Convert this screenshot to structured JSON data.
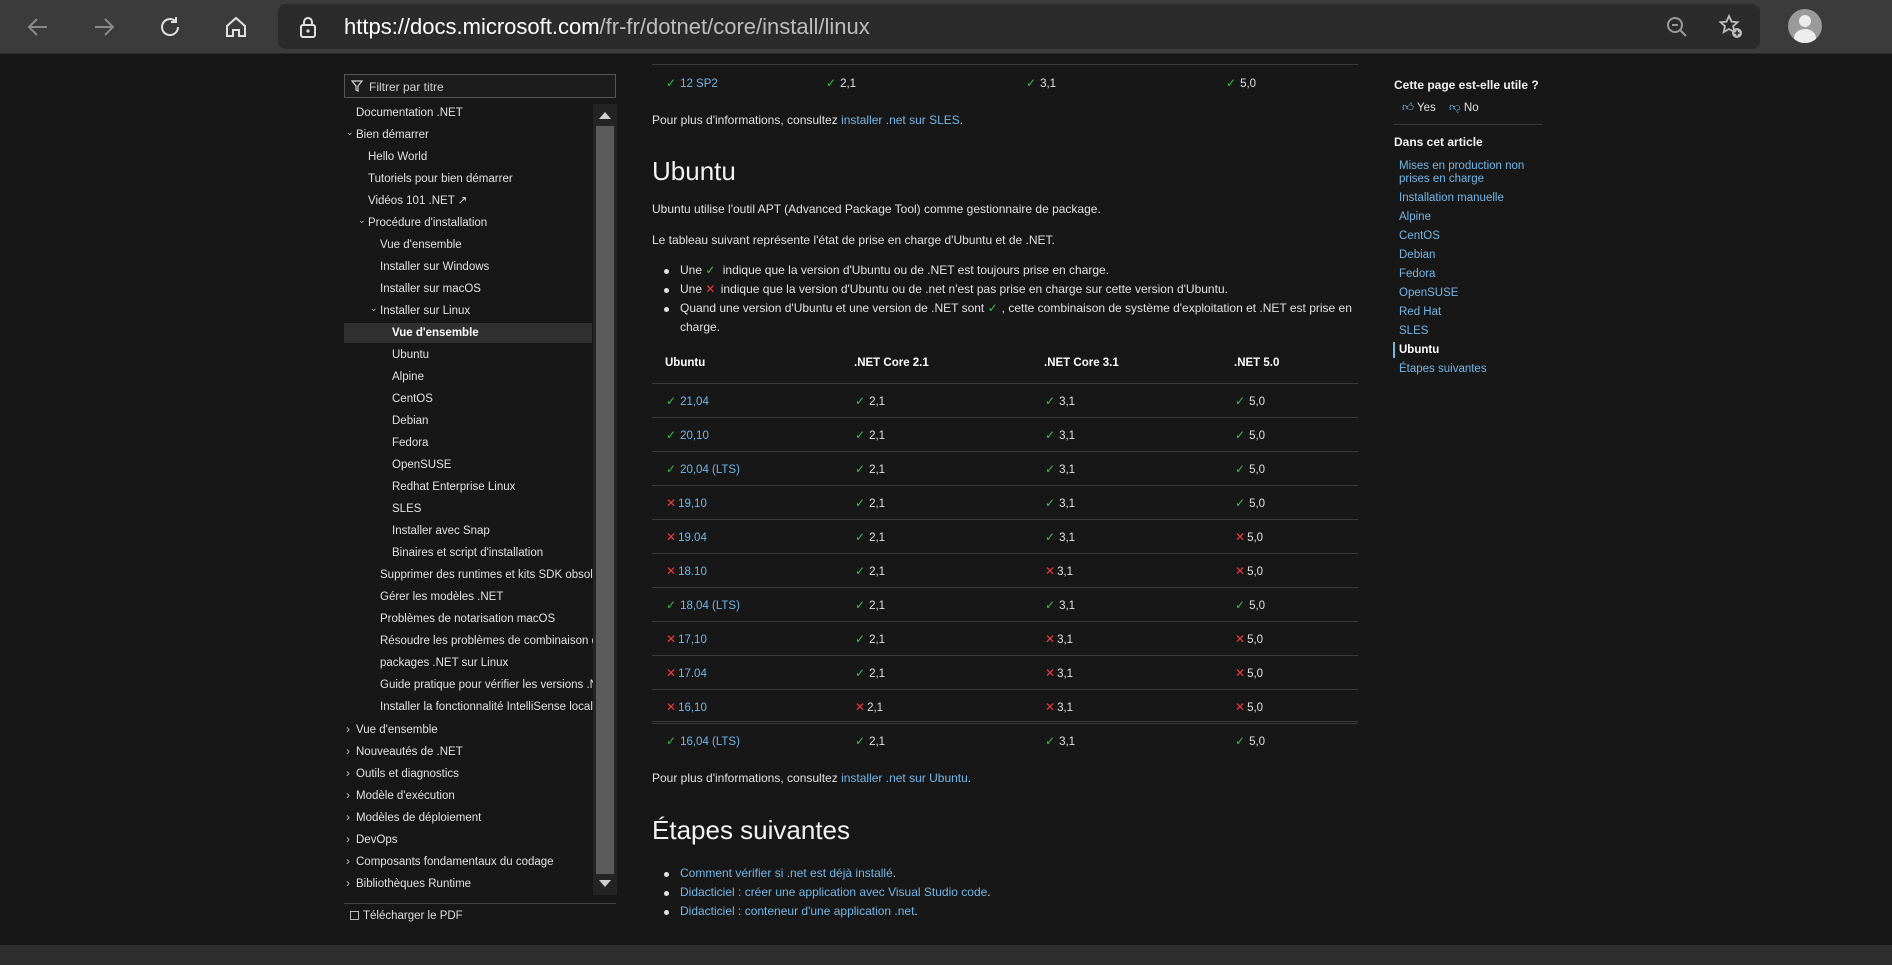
{
  "browser": {
    "url_host": "https://docs.microsoft.com",
    "url_path": "/fr-fr/dotnet/core/install/linux"
  },
  "toc": {
    "filter_placeholder": "Filtrer par titre",
    "items": [
      {
        "label": "Documentation .NET",
        "level": 0,
        "caret": ""
      },
      {
        "label": "Bien démarrer",
        "level": 0,
        "caret": "open"
      },
      {
        "label": "Hello World",
        "level": 1,
        "caret": ""
      },
      {
        "label": "Tutoriels pour bien démarrer",
        "level": 1,
        "caret": ""
      },
      {
        "label": "Vidéos 101 .NET ↗",
        "level": 1,
        "caret": ""
      },
      {
        "label": "Procédure d'installation",
        "level": 1,
        "caret": "open"
      },
      {
        "label": "Vue d'ensemble",
        "level": 2,
        "caret": ""
      },
      {
        "label": "Installer sur Windows",
        "level": 2,
        "caret": ""
      },
      {
        "label": "Installer sur macOS",
        "level": 2,
        "caret": ""
      },
      {
        "label": "Installer sur Linux",
        "level": 2,
        "caret": "open"
      },
      {
        "label": "Vue d'ensemble",
        "level": 3,
        "caret": "",
        "selected": true
      },
      {
        "label": "Ubuntu",
        "level": 3,
        "caret": ""
      },
      {
        "label": "Alpine",
        "level": 3,
        "caret": ""
      },
      {
        "label": "CentOS",
        "level": 3,
        "caret": ""
      },
      {
        "label": "Debian",
        "level": 3,
        "caret": ""
      },
      {
        "label": "Fedora",
        "level": 3,
        "caret": ""
      },
      {
        "label": "OpenSUSE",
        "level": 3,
        "caret": ""
      },
      {
        "label": "Redhat Enterprise Linux",
        "level": 3,
        "caret": ""
      },
      {
        "label": "SLES",
        "level": 3,
        "caret": ""
      },
      {
        "label": "Installer avec Snap",
        "level": 3,
        "caret": ""
      },
      {
        "label": "Binaires et script d'installation",
        "level": 3,
        "caret": ""
      },
      {
        "label": "Supprimer des runtimes et kits SDK obsolètes",
        "level": 2,
        "caret": ""
      },
      {
        "label": "Gérer les modèles .NET",
        "level": 2,
        "caret": ""
      },
      {
        "label": "Problèmes de notarisation macOS",
        "level": 2,
        "caret": ""
      },
      {
        "label": "Résoudre les problèmes de combinaison de",
        "level": 2,
        "caret": ""
      },
      {
        "label": "packages .NET sur Linux",
        "level": 2,
        "caret": "",
        "continuation": true
      },
      {
        "label": "Guide pratique pour vérifier les versions .NET",
        "level": 2,
        "caret": ""
      },
      {
        "label": "Installer la fonctionnalité IntelliSense localisée",
        "level": 2,
        "caret": ""
      },
      {
        "label": "Vue d'ensemble",
        "level": 0,
        "caret": "closed"
      },
      {
        "label": "Nouveautés de .NET",
        "level": 0,
        "caret": "closed"
      },
      {
        "label": "Outils et diagnostics",
        "level": 0,
        "caret": "closed"
      },
      {
        "label": "Modèle d'exécution",
        "level": 0,
        "caret": "closed"
      },
      {
        "label": "Modèles de déploiement",
        "level": 0,
        "caret": "closed"
      },
      {
        "label": "DevOps",
        "level": 0,
        "caret": "closed"
      },
      {
        "label": "Composants fondamentaux du codage",
        "level": 0,
        "caret": "closed"
      },
      {
        "label": "Bibliothèques Runtime",
        "level": 0,
        "caret": "closed"
      }
    ],
    "pdf_label": "Télécharger le PDF"
  },
  "main": {
    "sles_row": {
      "os": "12 SP2",
      "c21": "2,1",
      "c31": "3,1",
      "n5": "5,0"
    },
    "sles_more_prefix": "Pour plus d'informations, consultez ",
    "sles_more_link": "installer .net sur SLES",
    "sles_more_suffix": ".",
    "ubuntu_heading": "Ubuntu",
    "ubuntu_intro": "Ubuntu utilise l'outil APT (Advanced Package Tool) comme gestionnaire de package.",
    "table_intro": "Le tableau suivant représente l'état de prise en charge d'Ubuntu et de .NET.",
    "bullet1_a": "Une ",
    "bullet1_b": " indique que la version d'Ubuntu ou de .NET est toujours prise en charge.",
    "bullet2_a": "Une ",
    "bullet2_b": " indique que la version d'Ubuntu ou de .net n'est pas prise en charge sur cette version d'Ubuntu.",
    "bullet3_a": "Quand une version d'Ubuntu et une version de .NET sont ",
    "bullet3_b": ", cette combinaison de système d'exploitation et .NET est prise en",
    "bullet3_c": "charge.",
    "table_headers": [
      "Ubuntu",
      ".NET Core 2.1",
      ".NET Core 3.1",
      ".NET 5.0"
    ],
    "table_rows": [
      {
        "os": "21,04",
        "os_ok": true,
        "c21": "2,1",
        "c21_ok": true,
        "c31": "3,1",
        "c31_ok": true,
        "n5": "5,0",
        "n5_ok": true
      },
      {
        "os": "20,10",
        "os_ok": true,
        "c21": "2,1",
        "c21_ok": true,
        "c31": "3,1",
        "c31_ok": true,
        "n5": "5,0",
        "n5_ok": true
      },
      {
        "os": "20,04 (LTS)",
        "os_ok": true,
        "c21": "2,1",
        "c21_ok": true,
        "c31": "3,1",
        "c31_ok": true,
        "n5": "5,0",
        "n5_ok": true
      },
      {
        "os": "19,10",
        "os_ok": false,
        "c21": "2,1",
        "c21_ok": true,
        "c31": "3,1",
        "c31_ok": true,
        "n5": "5,0",
        "n5_ok": true
      },
      {
        "os": "19.04",
        "os_ok": false,
        "c21": "2,1",
        "c21_ok": true,
        "c31": "3,1",
        "c31_ok": true,
        "n5": "5,0",
        "n5_ok": false
      },
      {
        "os": "18.10",
        "os_ok": false,
        "c21": "2,1",
        "c21_ok": true,
        "c31": "3,1",
        "c31_ok": false,
        "n5": "5,0",
        "n5_ok": false
      },
      {
        "os": "18,04 (LTS)",
        "os_ok": true,
        "c21": "2,1",
        "c21_ok": true,
        "c31": "3,1",
        "c31_ok": true,
        "n5": "5,0",
        "n5_ok": true
      },
      {
        "os": "17,10",
        "os_ok": false,
        "c21": "2,1",
        "c21_ok": true,
        "c31": "3,1",
        "c31_ok": false,
        "n5": "5,0",
        "n5_ok": false
      },
      {
        "os": "17.04",
        "os_ok": false,
        "c21": "2,1",
        "c21_ok": true,
        "c31": "3,1",
        "c31_ok": false,
        "n5": "5,0",
        "n5_ok": false
      },
      {
        "os": "16,10",
        "os_ok": false,
        "c21": "2,1",
        "c21_ok": false,
        "c31": "3,1",
        "c31_ok": false,
        "n5": "5,0",
        "n5_ok": false
      },
      {
        "os": "16,04 (LTS)",
        "os_ok": true,
        "c21": "2,1",
        "c21_ok": true,
        "c31": "3,1",
        "c31_ok": true,
        "n5": "5,0",
        "n5_ok": true
      }
    ],
    "ubuntu_more_prefix": "Pour plus d'informations, consultez ",
    "ubuntu_more_link": "installer .net sur Ubuntu",
    "ubuntu_more_suffix": ".",
    "next_heading": "Étapes suivantes",
    "next_links": [
      "Comment vérifier si .net est déjà installé",
      "Didacticiel : créer une application avec Visual Studio code",
      "Didacticiel : conteneur d'une application .net"
    ],
    "next_suffix": "."
  },
  "right": {
    "helpful_title": "Cette page est-elle utile ?",
    "yes_label": "Yes",
    "no_label": "No",
    "article_title": "Dans cet article",
    "links": [
      "Mises en production non",
      "prises en charge",
      "Installation manuelle",
      "Alpine",
      "CentOS",
      "Debian",
      "Fedora",
      "OpenSUSE",
      "Red Hat",
      "SLES",
      "Ubuntu",
      "Étapes suivantes"
    ],
    "active_link": "Ubuntu"
  },
  "colors": {
    "ok": "#3fbf4f",
    "ko": "#f03a3a",
    "link": "#75b6e7"
  }
}
